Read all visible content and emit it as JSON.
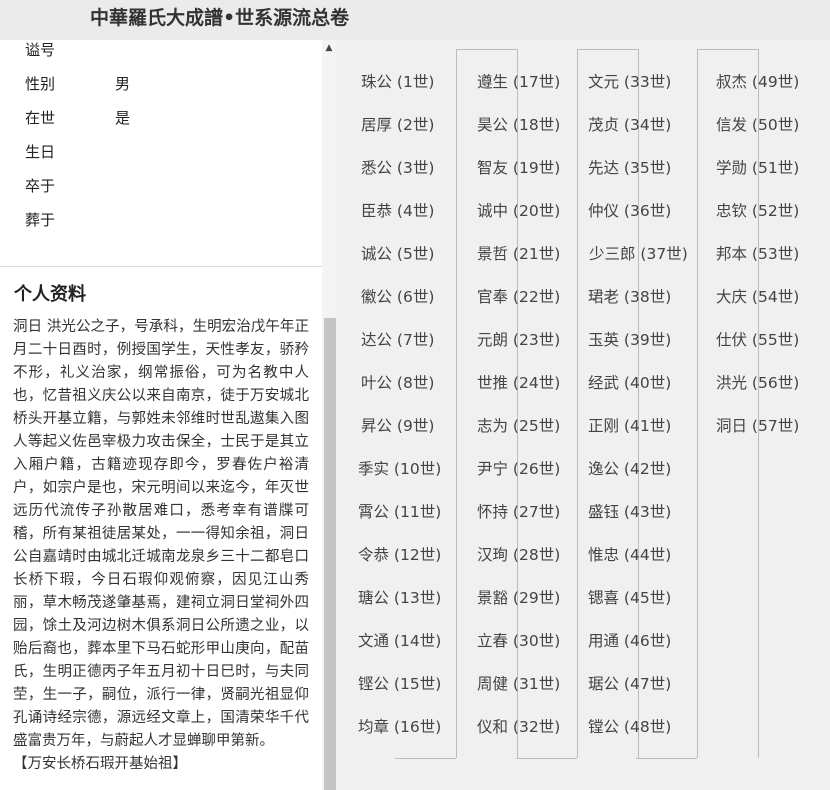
{
  "header": {
    "title": "中華羅氏大成譜•世系源流总卷"
  },
  "person": {
    "fields": [
      {
        "label": "谥号",
        "value": ""
      },
      {
        "label": "性别",
        "value": "男"
      },
      {
        "label": "在世",
        "value": "是"
      },
      {
        "label": "生日",
        "value": ""
      },
      {
        "label": "卒于",
        "value": ""
      },
      {
        "label": "葬于",
        "value": ""
      }
    ]
  },
  "profile": {
    "section_title": "个人资料",
    "bio": "洞日 洪光公之子，号承科，生明宏治戊午年正月二十日酉时，例授国学生，天性孝友，骄矜不形，礼义治家，纲常振俗，可为名教中人也，忆昔祖义庆公以来自南京，徒于万安城北桥头开基立籍，与郭姓未邻维时世乱遨集入图人等起义佐邑宰极力攻击保全，士民于是其立入厢户籍，古籍迹现存即今，罗春佐户裕清户，如宗户是也，宋元明间以来迄今，年灭世远历代流传子孙散居难口，悉考幸有谱牒可稽，所有某祖徒居某处，一一得知余祖，洞日公自嘉靖时由城北迁城南龙泉乡三十二都皂口长桥下瑕，今日石瑕仰观俯察，因见江山秀丽，草木畅茂遂肇基焉，建祠立洞日堂祠外四园，馀土及河边树木俱系洞日公所遗之业，以贻后裔也，葬本里下马石蛇形甲山庚向，配苗氏，生明正德丙子年五月初十日巳时，与夫同茔，生一子，嗣位，派行一律，贤嗣光祖显仰孔诵诗经宗德，源远经文章上，国清荣华千代盛富贵万年，与蔚起人才显蝉聊甲第新。",
    "note": "【万安长桥石瑕开基始祖】"
  },
  "generations": [
    [
      "珠公 (1世)",
      "居厚 (2世)",
      "悉公 (3世)",
      "臣恭 (4世)",
      "诚公 (5世)",
      "徽公 (6世)",
      "达公 (7世)",
      "叶公 (8世)",
      "昇公 (9世)",
      "季实 (10世)",
      "霄公 (11世)",
      "令恭 (12世)",
      "瑭公 (13世)",
      "文通 (14世)",
      "铿公 (15世)",
      "均章 (16世)"
    ],
    [
      "遵生 (17世)",
      "昊公 (18世)",
      "智友 (19世)",
      "诚中 (20世)",
      "景哲 (21世)",
      "官奉 (22世)",
      "元朗 (23世)",
      "世推 (24世)",
      "志为 (25世)",
      "尹宁 (26世)",
      "怀持 (27世)",
      "汉珣 (28世)",
      "景豁 (29世)",
      "立春 (30世)",
      "周健 (31世)",
      "仪和 (32世)"
    ],
    [
      "文元 (33世)",
      "茂贞 (34世)",
      "先达 (35世)",
      "仲仪 (36世)",
      "少三郎 (37世)",
      "珺老 (38世)",
      "玉英 (39世)",
      "经武 (40世)",
      "正刚 (41世)",
      "逸公 (42世)",
      "盛钰 (43世)",
      "惟忠 (44世)",
      "锶喜 (45世)",
      "用通 (46世)",
      "琚公 (47世)",
      "镗公 (48世)"
    ],
    [
      "叔杰 (49世)",
      "信发 (50世)",
      "学勋 (51世)",
      "忠钦 (52世)",
      "邦本 (53世)",
      "大庆 (54世)",
      "仕伏 (55世)",
      "洪光 (56世)",
      "洞日 (57世)"
    ]
  ]
}
